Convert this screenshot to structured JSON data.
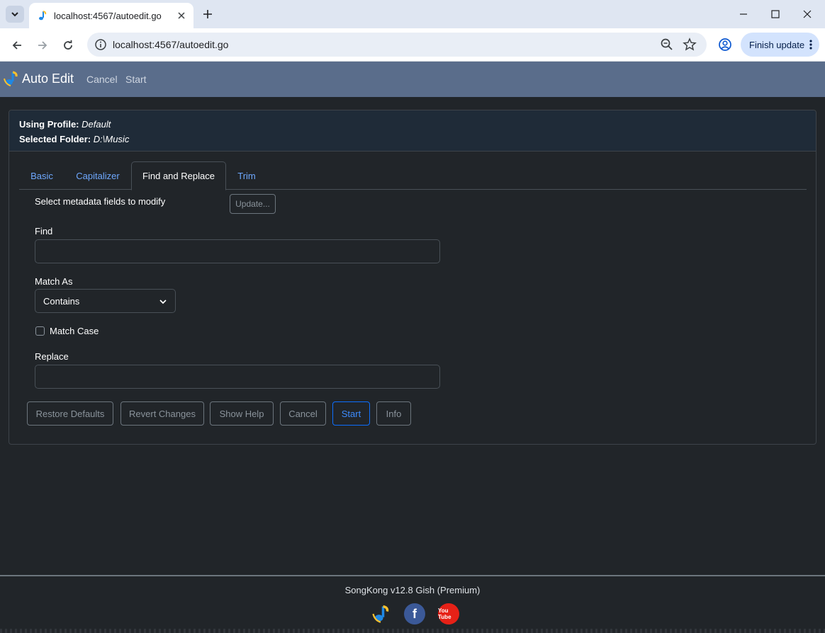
{
  "browser": {
    "tab_title": "localhost:4567/autoedit.go",
    "url": "localhost:4567/autoedit.go",
    "finish_update_label": "Finish update",
    "icons": {
      "tab_search": "chevron-down-icon",
      "favicon": "music-note-icon",
      "tab_close": "close-icon",
      "new_tab": "plus-icon",
      "minimize": "minimize-icon",
      "maximize": "maximize-icon",
      "close_window": "close-icon",
      "back": "arrow-left-icon",
      "forward": "arrow-right-icon",
      "reload": "reload-icon",
      "site_info": "info-icon",
      "zoom": "zoom-icon",
      "bookmark": "star-icon",
      "profile": "profile-icon",
      "menu": "vertical-dots-icon"
    }
  },
  "app": {
    "brand": "Auto Edit",
    "nav": {
      "cancel": "Cancel",
      "start": "Start"
    },
    "header": {
      "profile_label": "Using Profile:",
      "profile_value": "Default",
      "folder_label": "Selected Folder:",
      "folder_value": "D:\\Music"
    },
    "tabs": [
      {
        "label": "Basic",
        "active": false
      },
      {
        "label": "Capitalizer",
        "active": false
      },
      {
        "label": "Find and Replace",
        "active": true
      },
      {
        "label": "Trim",
        "active": false
      }
    ],
    "form": {
      "select_fields_label": "Select metadata fields to modify",
      "update_button": "Update...",
      "find_label": "Find",
      "find_value": "",
      "match_as_label": "Match As",
      "match_as_value": "Contains",
      "match_case_label": "Match Case",
      "match_case_checked": false,
      "replace_label": "Replace",
      "replace_value": ""
    },
    "buttons": {
      "restore_defaults": "Restore Defaults",
      "revert_changes": "Revert Changes",
      "show_help": "Show Help",
      "cancel": "Cancel",
      "start": "Start",
      "info": "Info"
    },
    "footer": {
      "version": "SongKong v12.8 Gish (Premium)",
      "facebook_glyph": "f",
      "youtube_glyph": "You Tube"
    },
    "colors": {
      "accent": "#0d6efd",
      "link": "#6ea8fe",
      "navbar": "#5a6d8b",
      "background": "#212529"
    }
  }
}
